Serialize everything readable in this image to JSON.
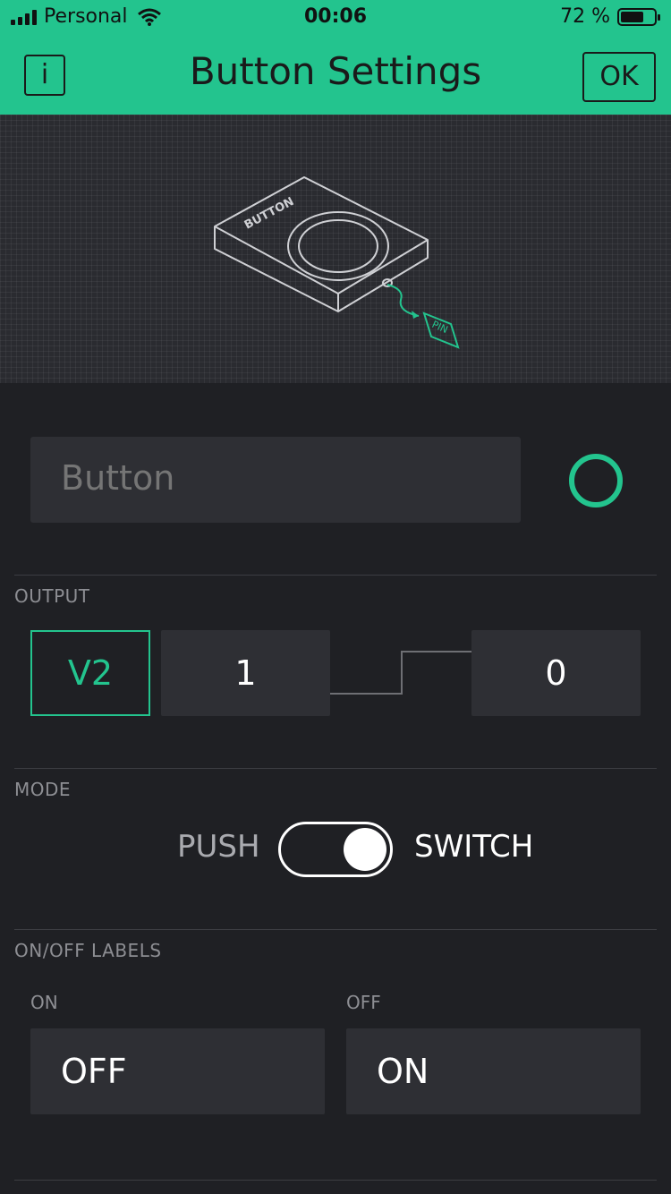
{
  "status_bar": {
    "carrier": "Personal",
    "time": "00:06",
    "battery_text": "72 %",
    "battery_level": 0.72
  },
  "nav": {
    "info_label": "i",
    "title": "Button Settings",
    "ok_label": "OK"
  },
  "illustration": {
    "device_label": "BUTTON",
    "pin_label": "PIN"
  },
  "name_field": {
    "placeholder": "Button"
  },
  "colors": {
    "accent": "#23c48e",
    "background": "#1f2024",
    "field": "#2e2f34"
  },
  "output": {
    "section_label": "OUTPUT",
    "pin": "V2",
    "high_value": "1",
    "low_value": "0"
  },
  "mode": {
    "section_label": "MODE",
    "push_label": "PUSH",
    "switch_label": "SWITCH",
    "selected": "SWITCH"
  },
  "labels": {
    "section_label": "ON/OFF LABELS",
    "on_caption": "ON",
    "off_caption": "OFF",
    "on_value": "OFF",
    "off_value": "ON"
  }
}
